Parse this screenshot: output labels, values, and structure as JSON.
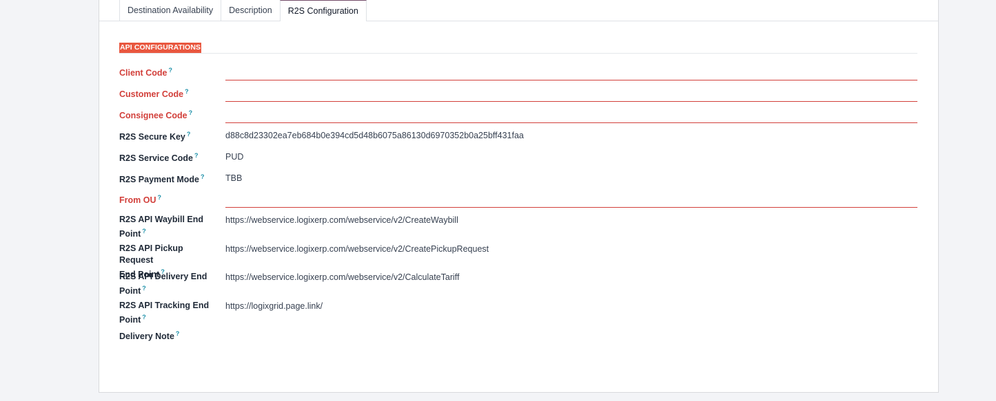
{
  "tabs": [
    {
      "label": "Destination Availability"
    },
    {
      "label": "Description"
    },
    {
      "label": "R2S Configuration"
    }
  ],
  "section": {
    "title": "API CONFIGURATIONS"
  },
  "help_mark": "?",
  "fields": {
    "client_code": {
      "label": "Client Code",
      "value": ""
    },
    "customer_code": {
      "label": "Customer Code",
      "value": ""
    },
    "consignee_code": {
      "label": "Consignee Code",
      "value": ""
    },
    "secure_key": {
      "label": "R2S Secure Key",
      "value": "d88c8d23302ea7eb684b0e394cd5d48b6075a86130d6970352b0a25bff431faa"
    },
    "service_code": {
      "label": "R2S Service Code",
      "value": "PUD"
    },
    "payment_mode": {
      "label": "R2S Payment Mode",
      "value": "TBB"
    },
    "from_ou": {
      "label": "From OU",
      "value": ""
    },
    "waybill_endpoint": {
      "label_line1": "R2S API Waybill End",
      "label_line2": "Point",
      "value": "https://webservice.logixerp.com/webservice/v2/CreateWaybill"
    },
    "pickup_endpoint": {
      "label_line1": "R2S API Pickup Request",
      "label_line2": "End Point",
      "value": "https://webservice.logixerp.com/webservice/v2/CreatePickupRequest"
    },
    "delivery_endpoint": {
      "label_line1": "R2S API Delivery End",
      "label_line2": "Point",
      "value": "https://webservice.logixerp.com/webservice/v2/CalculateTariff"
    },
    "tracking_endpoint": {
      "label_line1": "R2S API Tracking End",
      "label_line2": "Point",
      "value": "https://logixgrid.page.link/"
    },
    "delivery_note": {
      "label": "Delivery Note",
      "value": ""
    }
  },
  "colors": {
    "required": "#d23f3a",
    "section_bg": "#e9573f",
    "help": "#1b8fa8",
    "active_tab_accent": "#714b67"
  }
}
